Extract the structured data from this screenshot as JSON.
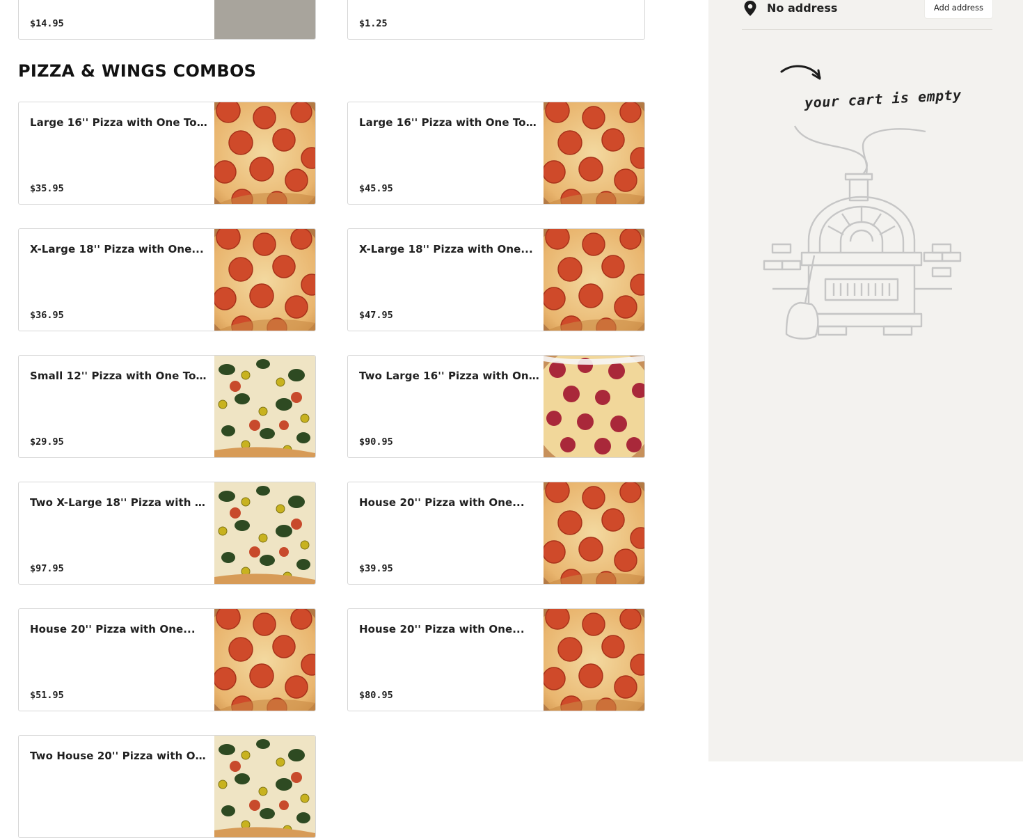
{
  "top_cards": [
    {
      "price": "$14.95",
      "image": "pizza-plain"
    },
    {
      "price": "$1.25",
      "image": null
    }
  ],
  "section": {
    "title": "PIZZA & WINGS COMBOS"
  },
  "items": [
    {
      "name": "Large 16'' Pizza with One Toppin...",
      "price": "$35.95",
      "image": "pepperoni-pizza"
    },
    {
      "name": "Large 16'' Pizza with One Toppin...",
      "price": "$45.95",
      "image": "pepperoni-pizza"
    },
    {
      "name": "X-Large 18'' Pizza with One...",
      "price": "$36.95",
      "image": "pepperoni-pizza"
    },
    {
      "name": "X-Large 18'' Pizza with One...",
      "price": "$47.95",
      "image": "pepperoni-pizza"
    },
    {
      "name": "Small 12'' Pizza with One Toppin...",
      "price": "$29.95",
      "image": "veggie-pizza"
    },
    {
      "name": "Two Large 16'' Pizza with One...",
      "price": "$90.95",
      "image": "meat-pizza"
    },
    {
      "name": "Two X-Large 18'' Pizza with One...",
      "price": "$97.95",
      "image": "veggie-pizza"
    },
    {
      "name": "House 20'' Pizza with One...",
      "price": "$39.95",
      "image": "pepperoni-pizza"
    },
    {
      "name": "House 20'' Pizza with One...",
      "price": "$51.95",
      "image": "pepperoni-pizza"
    },
    {
      "name": "House 20'' Pizza with One...",
      "price": "$80.95",
      "image": "pepperoni-pizza"
    },
    {
      "name": "Two House 20'' Pizza with One...",
      "price": "",
      "image": "veggie-pizza"
    }
  ],
  "sidebar": {
    "address_label": "No address",
    "add_address_button": "Add address",
    "cart_empty_text": "your cart is empty",
    "icons": {
      "pin": "location-pin-icon",
      "illustration": "pizza-oven-illustration"
    }
  },
  "colors": {
    "sidebar_bg": "#f3f2ef",
    "card_border": "#d7d7d7"
  }
}
